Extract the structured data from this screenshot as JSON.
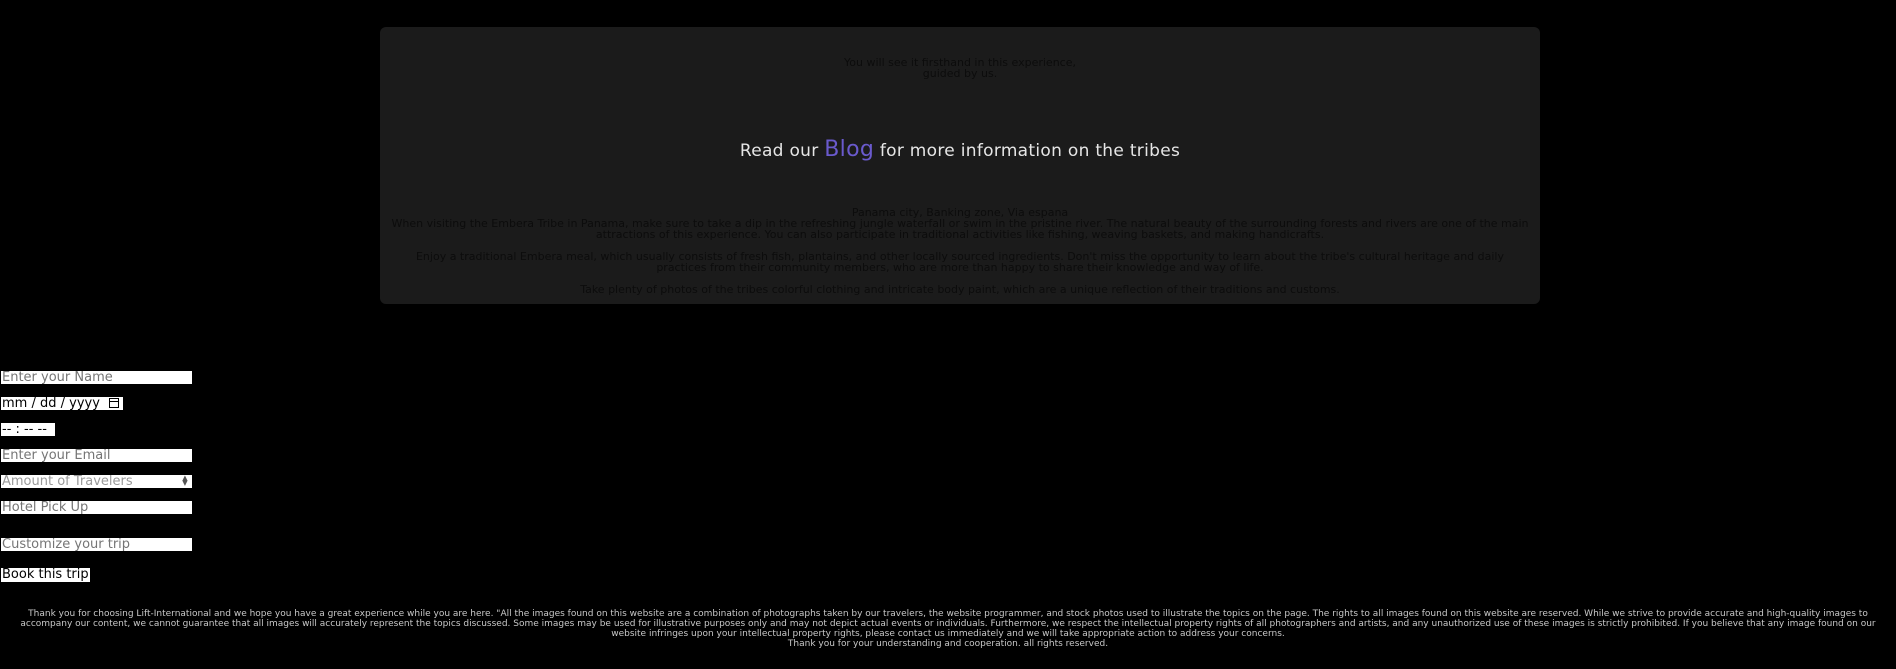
{
  "card": {
    "intro_line1": "You will see it firsthand in this experience,",
    "intro_line2": "guided by us.",
    "blog_prefix": "Read our",
    "blog_link": "Blog",
    "blog_suffix": "for more information on the tribes",
    "location": "Panama city, Banking zone, Via espana",
    "para1": "When visiting the Embera Tribe in Panama, make sure to take a dip in the refreshing jungle waterfall or swim in the pristine river. The natural beauty of the surrounding forests and rivers are one of the main attractions of this experience. You can also participate in traditional activities like fishing, weaving baskets, and making handicrafts.",
    "para2": "Enjoy a traditional Embera meal, which usually consists of fresh fish, plantains, and other locally sourced ingredients. Don't miss the opportunity to learn about the tribe's cultural heritage and daily practices from their community members, who are more than happy to share their knowledge and way of life.",
    "para3": "Take plenty of photos of the tribes colorful clothing and intricate body paint, which are a unique reflection of their traditions and customs."
  },
  "form": {
    "name_placeholder": "Enter your Name",
    "date_value": "mm / dd / yyyy",
    "time_value": "-- : --  --",
    "email_placeholder": "Enter your Email",
    "travelers_placeholder": "Amount of Travelers",
    "hotel_placeholder": "Hotel Pick Up",
    "customize_placeholder": "Customize your trip",
    "submit_label": "Book this trip"
  },
  "footer": {
    "disclaimer": "Thank you for choosing Lift-International and we hope you have a great experience while you are here. \"All the images found on this website are a combination of photographs taken by our travelers, the website programmer, and stock photos used to illustrate the topics on the page. The rights to all images found on this website are reserved. While we strive to provide accurate and high-quality images to accompany our content, we cannot guarantee that all images will accurately represent the topics discussed. Some images may be used for illustrative purposes only and may not depict actual events or individuals. Furthermore, we respect the intellectual property rights of all photographers and artists, and any unauthorized use of these images is strictly prohibited. If you believe that any image found on our website infringes upon your intellectual property rights, please contact us immediately and we will take appropriate action to address your concerns.",
    "thanks": "Thank you for your understanding and cooperation. all rights reserved."
  },
  "colors": {
    "background": "#000000",
    "card": "#1b1b1b",
    "blog_link": "#6a5acd"
  }
}
